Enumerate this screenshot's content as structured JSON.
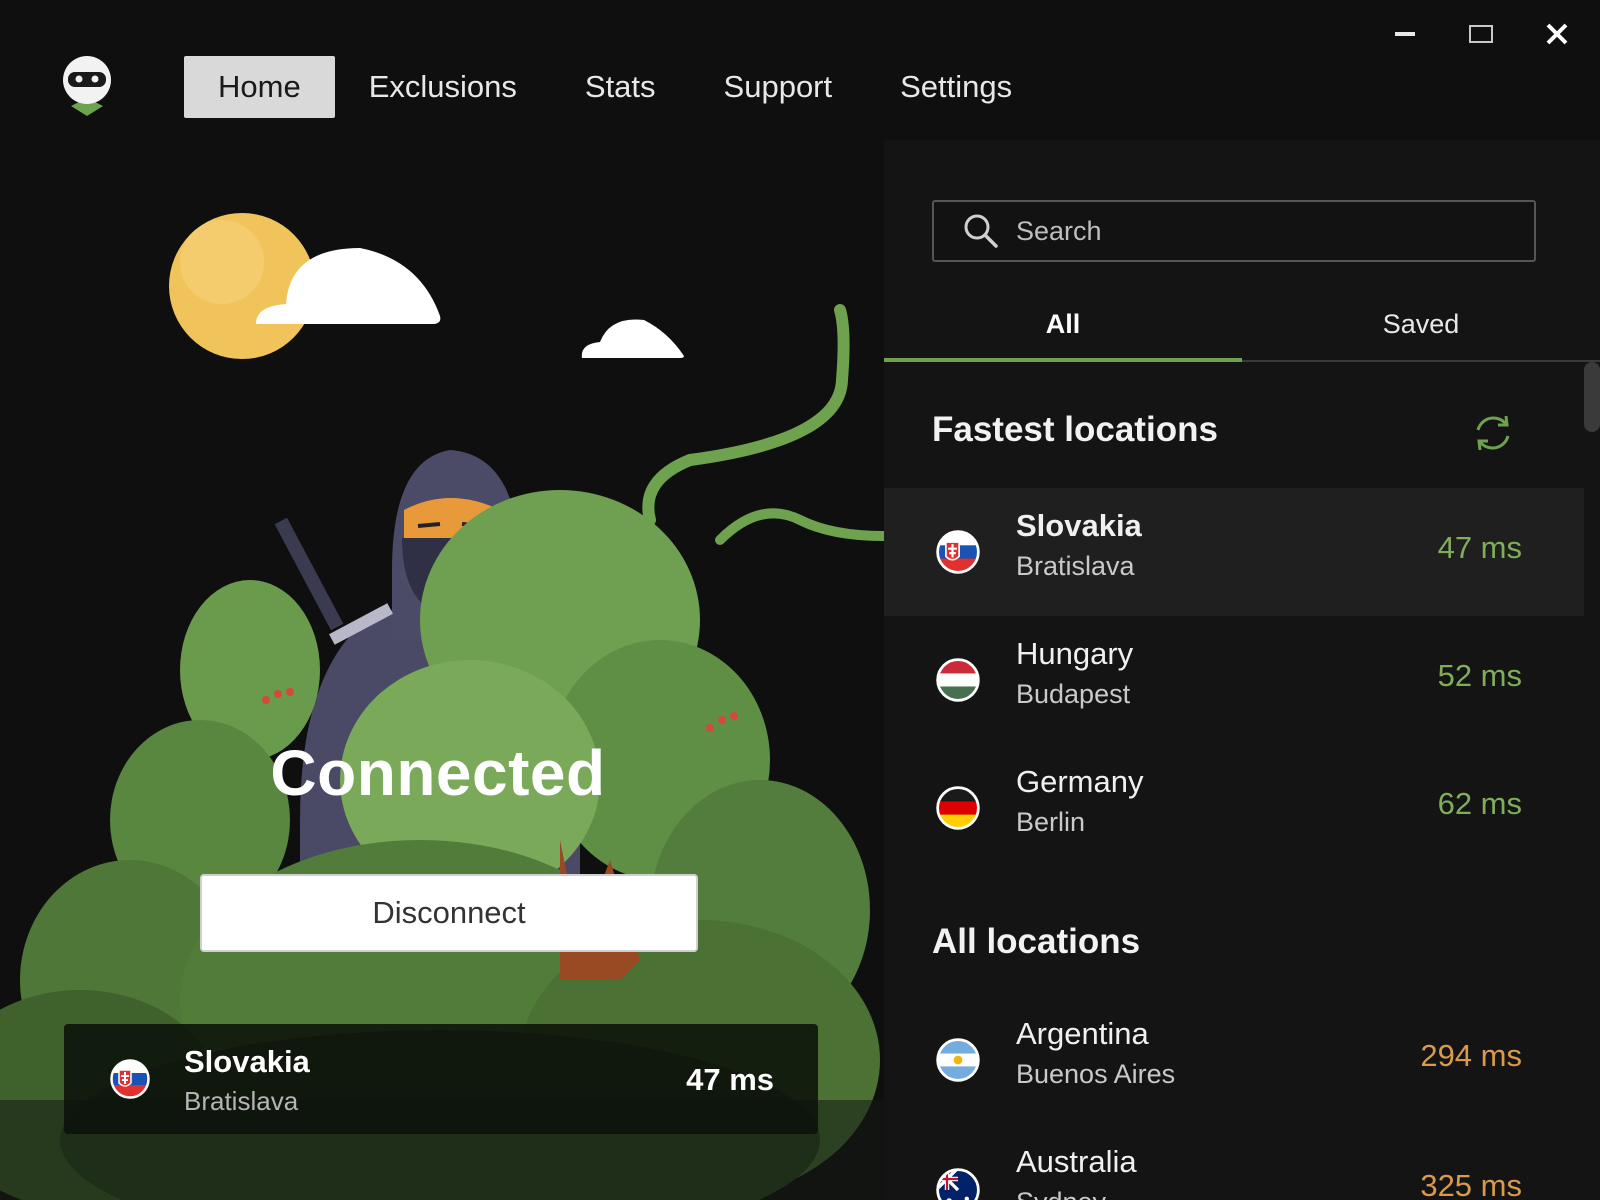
{
  "nav": {
    "tabs": [
      {
        "label": "Home",
        "active": true
      },
      {
        "label": "Exclusions",
        "active": false
      },
      {
        "label": "Stats",
        "active": false
      },
      {
        "label": "Support",
        "active": false
      },
      {
        "label": "Settings",
        "active": false
      }
    ]
  },
  "window_controls": {
    "minimize": "minimize-icon",
    "maximize": "maximize-icon",
    "close": "close-icon"
  },
  "status": {
    "text": "Connected"
  },
  "disconnect_button": {
    "label": "Disconnect"
  },
  "current_location": {
    "country": "Slovakia",
    "city": "Bratislava",
    "ping": "47 ms",
    "flag": "flag-slovakia"
  },
  "search": {
    "placeholder": "Search"
  },
  "list_tabs": {
    "all": "All",
    "saved": "Saved",
    "active": "All"
  },
  "fastest": {
    "title": "Fastest locations",
    "items": [
      {
        "country": "Slovakia",
        "city": "Bratislava",
        "ping": "47 ms",
        "flag": "flag-slovakia",
        "selected": true
      },
      {
        "country": "Hungary",
        "city": "Budapest",
        "ping": "52 ms",
        "flag": "flag-hungary",
        "selected": false
      },
      {
        "country": "Germany",
        "city": "Berlin",
        "ping": "62 ms",
        "flag": "flag-germany",
        "selected": false
      }
    ]
  },
  "all_locations": {
    "title": "All locations",
    "items": [
      {
        "country": "Argentina",
        "city": "Buenos Aires",
        "ping": "294 ms",
        "flag": "flag-argentina"
      },
      {
        "country": "Australia",
        "city": "Sydney",
        "ping": "325 ms",
        "flag": "flag-australia"
      }
    ]
  },
  "colors": {
    "accent_green": "#6fa24f",
    "ping_good": "#7fae5a",
    "ping_slow": "#d99a4a",
    "background": "#0f0f0f"
  }
}
